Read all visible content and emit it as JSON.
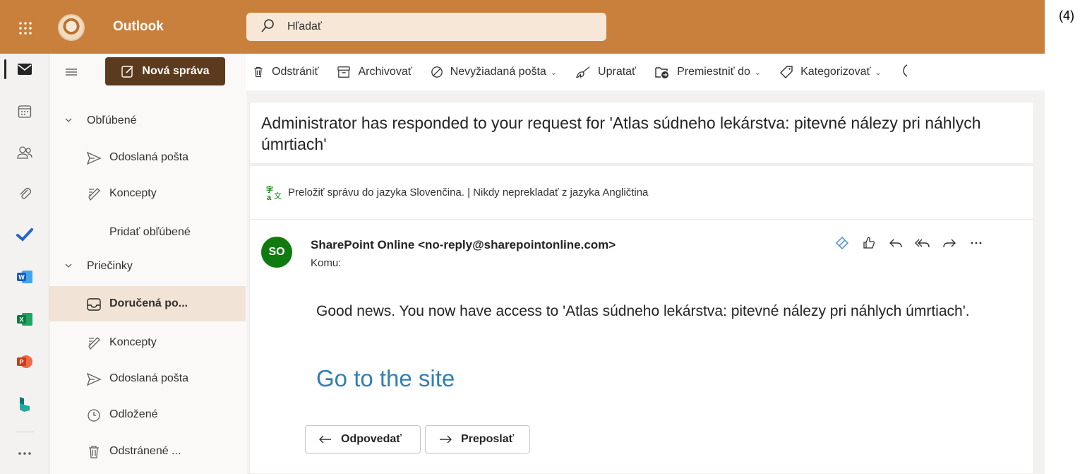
{
  "app": {
    "name": "Outlook"
  },
  "search": {
    "placeholder": "Hľadať"
  },
  "page_number": "(4)",
  "rail": [
    "mail-icon",
    "calendar-icon",
    "people-icon",
    "attachment-icon",
    "todo-icon",
    "word-icon",
    "excel-icon",
    "powerpoint-icon",
    "bookings-icon",
    "more-apps-icon"
  ],
  "folders": {
    "new_message_label": "Nová správa",
    "favorites_label": "Obľúbené",
    "favorites": [
      {
        "label": "Odoslaná pošta",
        "icon": "send-icon"
      },
      {
        "label": "Koncepty",
        "icon": "draft-icon"
      },
      {
        "label": "Pridať obľúbené",
        "icon": ""
      }
    ],
    "folders_label": "Priečinky",
    "items": [
      {
        "label": "Doručená po...",
        "icon": "inbox-icon",
        "selected": true
      },
      {
        "label": "Koncepty",
        "icon": "draft-icon"
      },
      {
        "label": "Odoslaná pošta",
        "icon": "send-icon"
      },
      {
        "label": "Odložené",
        "icon": "clock-icon"
      },
      {
        "label": "Odstránené ...",
        "icon": "trash-icon"
      }
    ]
  },
  "toolbar": {
    "delete": "Odstrániť",
    "archive": "Archivovať",
    "junk": "Nevyžiadaná pošta",
    "sweep": "Upratať",
    "move": "Premiestniť do",
    "categorize": "Kategorizovať"
  },
  "message": {
    "subject": "Administrator has responded to your request for 'Atlas súdneho lekárstva: pitevné nálezy pri náhlych úmrtiach'",
    "translate_bar": "Preložiť správu do jazyka Slovenčina. | Nikdy neprekladať z jazyka Angličtina",
    "avatar_initials": "SO",
    "sender": "SharePoint Online <no-reply@sharepointonline.com>",
    "to_label": "Komu:",
    "body": "Good news. You now have access to 'Atlas súdneho lekárstva: pitevné nálezy pri náhlych úmrtiach'.",
    "link_text": "Go to the site",
    "reply_label": "Odpovedať",
    "forward_label": "Preposlať"
  },
  "colors": {
    "header": "#c9803c",
    "new_message_button": "#5c3a1e",
    "avatar": "#107c10",
    "link": "#2f7fb5",
    "selected_folder": "#f1e3d5"
  }
}
